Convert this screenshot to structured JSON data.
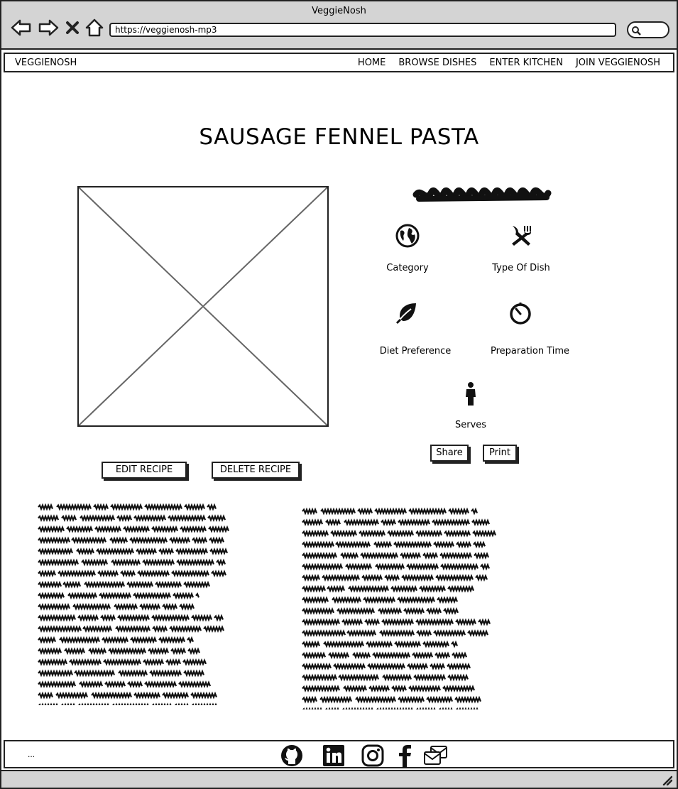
{
  "window": {
    "title": "VeggieNosh"
  },
  "browser": {
    "url": "https://veggienosh-mp3"
  },
  "navbar": {
    "brand": "VEGGIENOSH",
    "links": [
      "HOME",
      "BROWSE DISHES",
      "ENTER KITCHEN",
      "JOIN VEGGIENOSH"
    ]
  },
  "recipe": {
    "title": "SAUSAGE FENNEL PASTA",
    "info": {
      "category": "Category",
      "type_of_dish": "Type Of Dish",
      "diet_preference": "Diet Preference",
      "preparation_time": "Preparation Time",
      "serves": "Serves"
    },
    "share_label": "Share",
    "print_label": "Print",
    "edit_label": "EDIT RECIPE",
    "delete_label": "DELETE RECIPE"
  },
  "footer": {
    "text": "...",
    "social_icons": [
      "github-icon",
      "linkedin-icon",
      "instagram-icon",
      "facebook-icon",
      "mail-icon"
    ]
  },
  "icons": {
    "category": "globe-icon",
    "type_of_dish": "utensils-icon",
    "diet_preference": "leaf-icon",
    "preparation_time": "timer-icon",
    "serves": "person-icon"
  }
}
